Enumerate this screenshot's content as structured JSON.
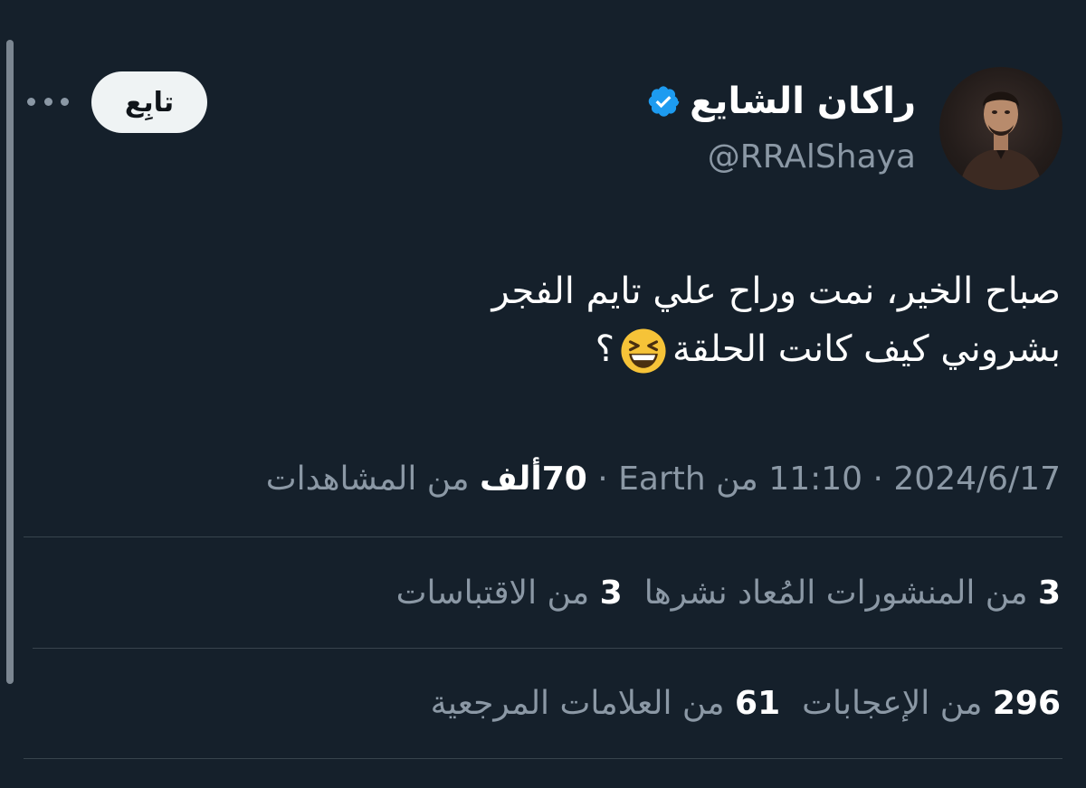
{
  "author": {
    "display_name": "راكان الشايع",
    "handle": "@RRAlShaya"
  },
  "follow_button": {
    "label": "تابِع"
  },
  "tweet": {
    "line1": "صباح الخير، نمت وراح علي تايم الفجر",
    "line2_start": "بشروني كيف كانت الحلقة",
    "line2_end": "؟"
  },
  "meta": {
    "date": "2024/6/17",
    "separator": "·",
    "time": "11:10",
    "source_prefix": "من",
    "source": "Earth",
    "views_count": "70ألف",
    "views_label": "من المشاهدات"
  },
  "stats": {
    "reposts_count": "3",
    "reposts_label": "من المنشورات المُعاد نشرها",
    "quotes_count": "3",
    "quotes_label": "من الاقتباسات",
    "likes_count": "296",
    "likes_label": "من الإعجابات",
    "bookmarks_count": "61",
    "bookmarks_label": "من العلامات المرجعية"
  },
  "colors": {
    "background": "#15202b",
    "text_primary": "#ffffff",
    "text_secondary": "#8b98a5",
    "verified_blue": "#1d9bf0",
    "divider": "#38444d"
  }
}
